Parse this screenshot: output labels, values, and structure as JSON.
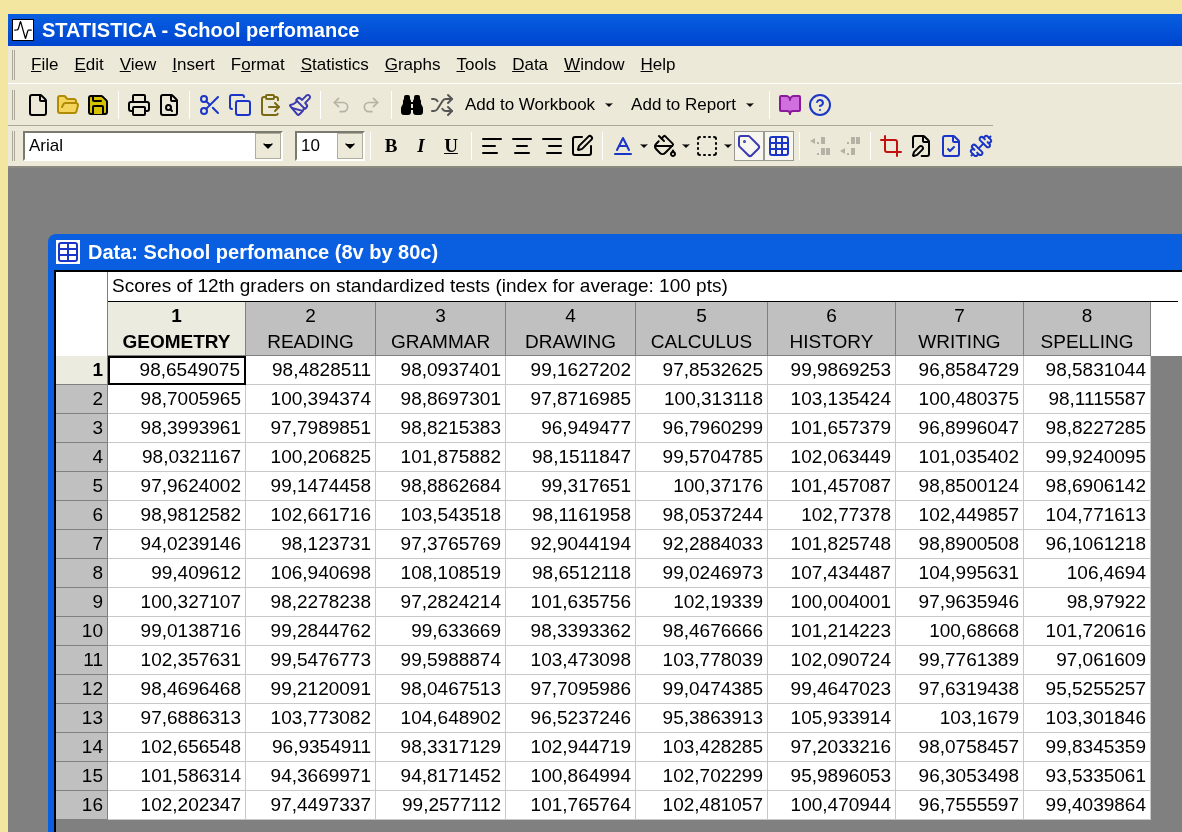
{
  "window": {
    "title": "STATISTICA - School perfomance"
  },
  "menu": [
    {
      "access_key": "F",
      "rest": "ile"
    },
    {
      "access_key": "E",
      "rest": "dit"
    },
    {
      "access_key": "V",
      "rest": "iew"
    },
    {
      "access_key": "I",
      "rest": "nsert"
    },
    {
      "before": "F",
      "access_key": "o",
      "rest": "rmat"
    },
    {
      "access_key": "S",
      "rest": "tatistics"
    },
    {
      "access_key": "G",
      "rest": "raphs"
    },
    {
      "access_key": "T",
      "rest": "ools"
    },
    {
      "access_key": "D",
      "rest": "ata"
    },
    {
      "access_key": "W",
      "rest": "indow"
    },
    {
      "access_key": "H",
      "rest": "elp"
    }
  ],
  "toolbar": {
    "undo": {
      "disabled": true
    },
    "redo": {
      "disabled": true
    },
    "add_to_workbook": "Add to Workbook",
    "add_to_report": "Add to Report"
  },
  "format_bar": {
    "font": "Arial",
    "size": "10",
    "bold": "B",
    "italic": "I",
    "underline": "U",
    "tag": {
      "pressed": true
    },
    "grid": {
      "pressed": true
    },
    "increase_decimal": {
      "disabled": true
    },
    "decrease_decimal": {
      "disabled": true
    }
  },
  "spreadsheet": {
    "title": "Data: School perfomance (8v by 80c)",
    "note": "Scores of 12th graders on standardized tests (index for average: 100 pts)",
    "columns": [
      {
        "number": "1",
        "name": "GEOMETRY",
        "selected": true
      },
      {
        "number": "2",
        "name": "READING",
        "selected": false
      },
      {
        "number": "3",
        "name": "GRAMMAR",
        "selected": false
      },
      {
        "number": "4",
        "name": "DRAWING",
        "selected": false
      },
      {
        "number": "5",
        "name": "CALCULUS",
        "selected": false
      },
      {
        "number": "6",
        "name": "HISTORY",
        "selected": false
      },
      {
        "number": "7",
        "name": "WRITING",
        "selected": false
      },
      {
        "number": "8",
        "name": "SPELLING",
        "selected": false
      }
    ],
    "rows": [
      {
        "label": "1",
        "selected": true,
        "cells": [
          "98,6549075",
          "98,4828511",
          "98,0937401",
          "99,1627202",
          "97,8532625",
          "99,9869253",
          "96,8584729",
          "98,5831044"
        ]
      },
      {
        "label": "2",
        "selected": false,
        "cells": [
          "98,7005965",
          "100,394374",
          "98,8697301",
          "97,8716985",
          "100,313118",
          "103,135424",
          "100,480375",
          "98,1115587"
        ]
      },
      {
        "label": "3",
        "selected": false,
        "cells": [
          "98,3993961",
          "97,7989851",
          "98,8215383",
          "96,949477",
          "96,7960299",
          "101,657379",
          "96,8996047",
          "98,8227285"
        ]
      },
      {
        "label": "4",
        "selected": false,
        "cells": [
          "98,0321167",
          "100,206825",
          "101,875882",
          "98,1511847",
          "99,5704785",
          "102,063449",
          "101,035402",
          "99,9240095"
        ]
      },
      {
        "label": "5",
        "selected": false,
        "cells": [
          "97,9624002",
          "99,1474458",
          "98,8862684",
          "99,317651",
          "100,37176",
          "101,457087",
          "98,8500124",
          "98,6906142"
        ]
      },
      {
        "label": "6",
        "selected": false,
        "cells": [
          "98,9812582",
          "102,661716",
          "103,543518",
          "98,1161958",
          "98,0537244",
          "102,77378",
          "102,449857",
          "104,771613"
        ]
      },
      {
        "label": "7",
        "selected": false,
        "cells": [
          "94,0239146",
          "98,123731",
          "97,3765769",
          "92,9044194",
          "92,2884033",
          "101,825748",
          "98,8900508",
          "96,1061218"
        ]
      },
      {
        "label": "8",
        "selected": false,
        "cells": [
          "99,409612",
          "106,940698",
          "108,108519",
          "98,6512118",
          "99,0246973",
          "107,434487",
          "104,995631",
          "106,4694"
        ]
      },
      {
        "label": "9",
        "selected": false,
        "cells": [
          "100,327107",
          "98,2278238",
          "97,2824214",
          "101,635756",
          "102,19339",
          "100,004001",
          "97,9635946",
          "98,97922"
        ]
      },
      {
        "label": "10",
        "selected": false,
        "cells": [
          "99,0138716",
          "99,2844762",
          "99,633669",
          "98,3393362",
          "98,4676666",
          "101,214223",
          "100,68668",
          "101,720616"
        ]
      },
      {
        "label": "11",
        "selected": false,
        "cells": [
          "102,357631",
          "99,5476773",
          "99,5988874",
          "103,473098",
          "103,778039",
          "102,090724",
          "99,7761389",
          "97,061609"
        ]
      },
      {
        "label": "12",
        "selected": false,
        "cells": [
          "98,4696468",
          "99,2120091",
          "98,0467513",
          "97,7095986",
          "99,0474385",
          "99,4647023",
          "97,6319438",
          "95,5255257"
        ]
      },
      {
        "label": "13",
        "selected": false,
        "cells": [
          "97,6886313",
          "103,773082",
          "104,648902",
          "96,5237246",
          "95,3863913",
          "105,933914",
          "103,1679",
          "103,301846"
        ]
      },
      {
        "label": "14",
        "selected": false,
        "cells": [
          "102,656548",
          "96,9354911",
          "98,3317129",
          "102,944719",
          "103,428285",
          "97,2033216",
          "98,0758457",
          "99,8345359"
        ]
      },
      {
        "label": "15",
        "selected": false,
        "cells": [
          "101,586314",
          "94,3669971",
          "94,8171452",
          "100,864994",
          "102,702299",
          "95,9896053",
          "96,3053498",
          "93,5335061"
        ]
      },
      {
        "label": "16",
        "selected": false,
        "cells": [
          "102,202347",
          "97,4497337",
          "99,2577112",
          "101,765764",
          "102,481057",
          "100,470944",
          "96,7555597",
          "99,4039864"
        ]
      }
    ]
  }
}
